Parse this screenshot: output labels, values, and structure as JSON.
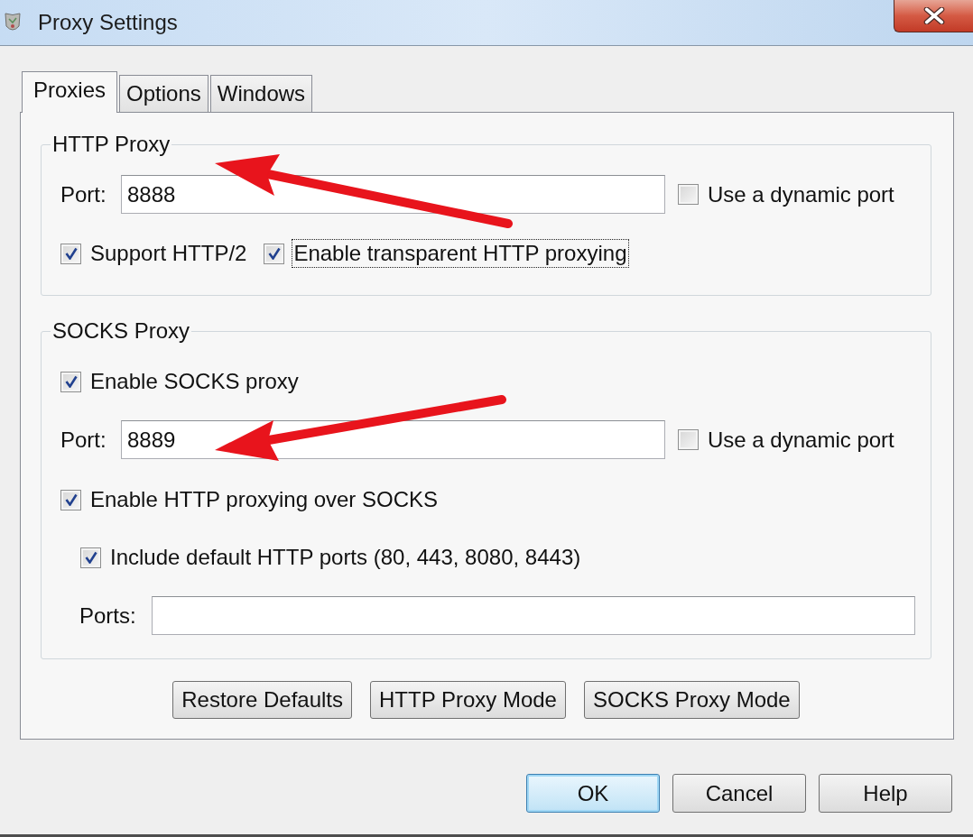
{
  "window": {
    "title": "Proxy Settings"
  },
  "tabs": [
    {
      "label": "Proxies",
      "selected": true
    },
    {
      "label": "Options",
      "selected": false
    },
    {
      "label": "Windows",
      "selected": false
    }
  ],
  "http_proxy": {
    "legend": "HTTP Proxy",
    "port_label": "Port:",
    "port_value": "8888",
    "dynamic_port": {
      "label": "Use a dynamic port",
      "checked": false
    },
    "options": [
      {
        "label": "Support HTTP/2",
        "checked": true,
        "focused": false
      },
      {
        "label": "Enable transparent HTTP proxying",
        "checked": true,
        "focused": true
      }
    ]
  },
  "socks_proxy": {
    "legend": "SOCKS Proxy",
    "enable": {
      "label": "Enable SOCKS proxy",
      "checked": true
    },
    "port_label": "Port:",
    "port_value": "8889",
    "dynamic_port": {
      "label": "Use a dynamic port",
      "checked": false
    },
    "http_over_socks": {
      "label": "Enable HTTP proxying over SOCKS",
      "checked": true
    },
    "include_default_ports": {
      "label": "Include default HTTP ports (80, 443, 8080, 8443)",
      "checked": true
    },
    "ports_label": "Ports:"
  },
  "mode_buttons": [
    "Restore Defaults",
    "HTTP Proxy Mode",
    "SOCKS Proxy Mode"
  ],
  "dialog_buttons": [
    {
      "label": "OK",
      "default": true
    },
    {
      "label": "Cancel",
      "default": false
    },
    {
      "label": "Help",
      "default": false
    }
  ]
}
